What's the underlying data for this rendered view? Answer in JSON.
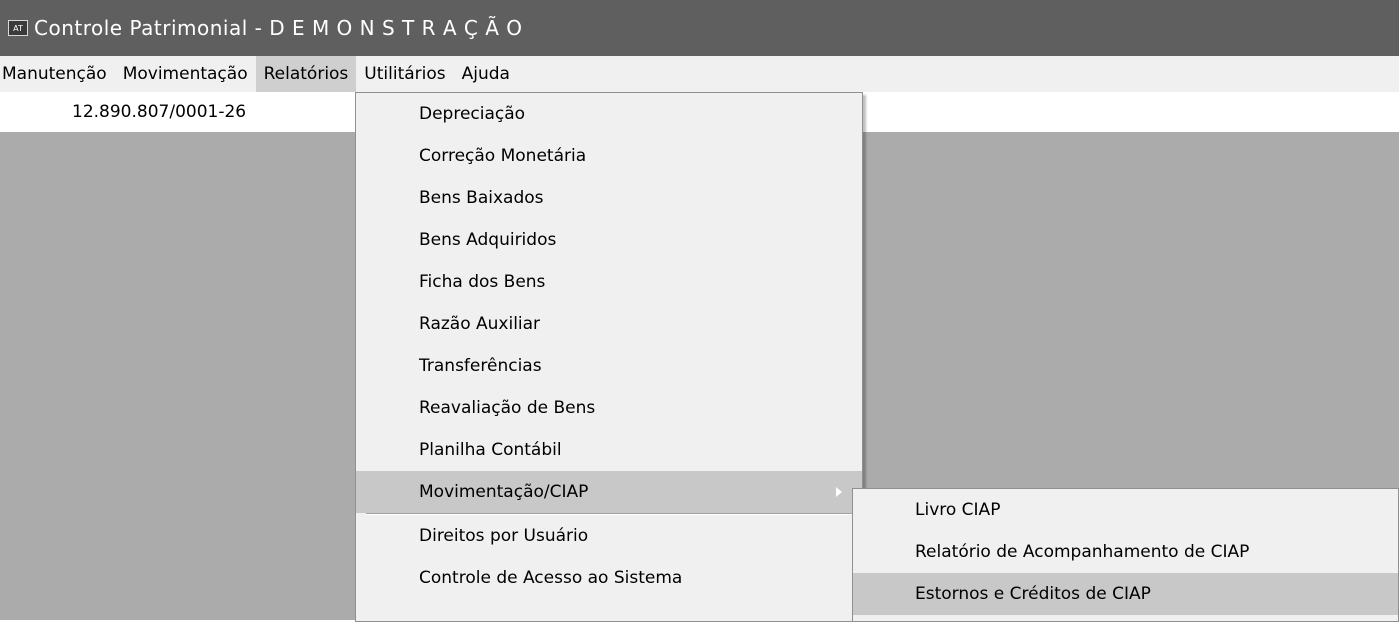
{
  "window": {
    "icon_text": "AT",
    "title": "Controle Patrimonial - D E M O N S T R A Ç Ã O"
  },
  "menubar": {
    "items": [
      "Manutenção",
      "Movimentação",
      "Relatórios",
      "Utilitários",
      "Ajuda"
    ],
    "active": "Relatórios"
  },
  "status": {
    "cnpj": "12.890.807/0001-26"
  },
  "relatorios_menu": {
    "items": [
      "Depreciação",
      "Correção Monetária",
      "Bens Baixados",
      "Bens Adquiridos",
      "Ficha dos Bens",
      "Razão Auxiliar",
      "Transferências",
      "Reavaliação de Bens",
      "Planilha Contábil",
      "Movimentação/CIAP",
      "Direitos por Usuário",
      "Controle de Acesso ao Sistema"
    ],
    "highlighted": "Movimentação/CIAP"
  },
  "ciap_submenu": {
    "items": [
      "Livro CIAP",
      "Relatório de Acompanhamento de CIAP",
      "Estornos e Créditos de CIAP"
    ],
    "highlighted": "Estornos e Créditos de CIAP"
  },
  "colors": {
    "titlebar": "#5f5f5f",
    "menu_bg": "#f0f0f0",
    "desktop": "#ababab",
    "highlight": "#c8c8c8"
  }
}
